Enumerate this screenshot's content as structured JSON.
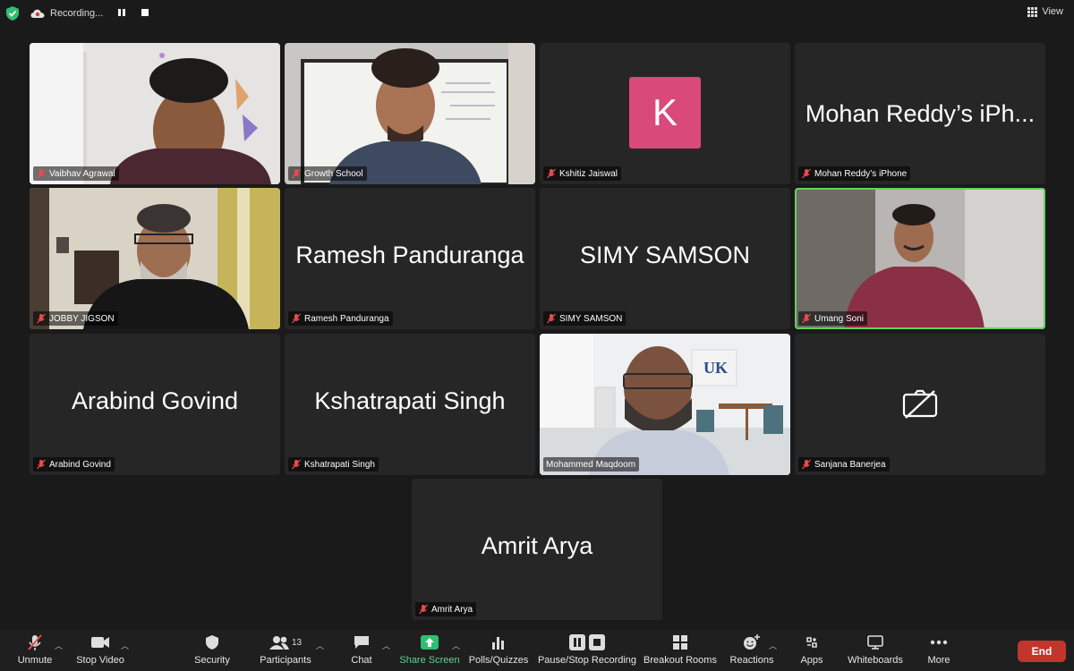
{
  "topbar": {
    "recording_label": "Recording...",
    "view_label": "View"
  },
  "tiles": [
    {
      "name": "Vaibhav Agrawal",
      "muted": true,
      "type": "video"
    },
    {
      "name": "Growth School",
      "muted": true,
      "type": "video"
    },
    {
      "name": "Kshitiz Jaiswal",
      "muted": true,
      "type": "avatar",
      "avatar_letter": "K"
    },
    {
      "name": "Mohan Reddy’s iPhone",
      "muted": true,
      "type": "name",
      "display": "Mohan Reddy’s iPh..."
    },
    {
      "name": "JOBBY JIGSON",
      "muted": true,
      "type": "video"
    },
    {
      "name": "Ramesh Panduranga",
      "muted": true,
      "type": "name",
      "display": "Ramesh Panduranga"
    },
    {
      "name": "SIMY SAMSON",
      "muted": true,
      "type": "name",
      "display": "SIMY SAMSON"
    },
    {
      "name": "Umang Soni",
      "muted": true,
      "type": "video",
      "active_speaker": true
    },
    {
      "name": "Arabind Govind",
      "muted": true,
      "type": "name",
      "display": "Arabind Govind"
    },
    {
      "name": "Kshatrapati Singh",
      "muted": true,
      "type": "name",
      "display": "Kshatrapati Singh"
    },
    {
      "name": "Mohammed Maqdoom",
      "muted": false,
      "type": "video"
    },
    {
      "name": "Sanjana Banerjea",
      "muted": true,
      "type": "camera-off"
    },
    {
      "name": "Amrit Arya",
      "muted": true,
      "type": "name",
      "display": "Amrit Arya"
    }
  ],
  "toolbar": {
    "unmute": "Unmute",
    "stop_video": "Stop Video",
    "security": "Security",
    "participants": "Participants",
    "participants_count": "13",
    "chat": "Chat",
    "share_screen": "Share Screen",
    "polls": "Polls/Quizzes",
    "pause_recording": "Pause/Stop Recording",
    "breakout": "Breakout Rooms",
    "reactions": "Reactions",
    "apps": "Apps",
    "whiteboards": "Whiteboards",
    "more": "More",
    "end": "End"
  },
  "colors": {
    "accent_green": "#5fd35f",
    "end_red": "#c0362c",
    "avatar_pink": "#d9497a",
    "share_green": "#2fbf71"
  }
}
